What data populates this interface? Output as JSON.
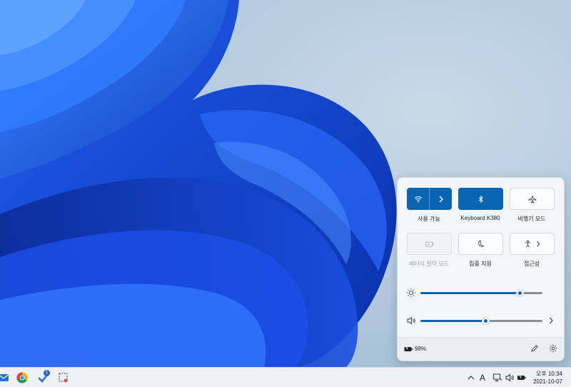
{
  "quick_settings": {
    "tiles": [
      {
        "id": "wifi",
        "label": "사용 가능",
        "icon": "wifi-icon",
        "state": "on"
      },
      {
        "id": "bluetooth",
        "label": "Keyboard K380",
        "icon": "bluetooth-icon",
        "state": "on"
      },
      {
        "id": "airplane",
        "label": "비행기 모드",
        "icon": "airplane-icon",
        "state": "off"
      },
      {
        "id": "battery-saver",
        "label": "배터리 절약 모드",
        "icon": "battery-saver-icon",
        "state": "disabled"
      },
      {
        "id": "focus",
        "label": "집중 지원",
        "icon": "moon-icon",
        "state": "off"
      },
      {
        "id": "accessibility",
        "label": "접근성",
        "icon": "accessibility-icon",
        "state": "off"
      }
    ],
    "brightness": {
      "icon": "sun-icon",
      "level": 0.81
    },
    "volume": {
      "icon": "speaker-icon",
      "level": 0.53
    },
    "battery_percent": "98%",
    "colors": {
      "accent": "#0a64b4"
    }
  },
  "taskbar": {
    "ime_mode": "A",
    "time": "오후 10:34",
    "date": "2021-10-07",
    "badge_count": "1"
  }
}
